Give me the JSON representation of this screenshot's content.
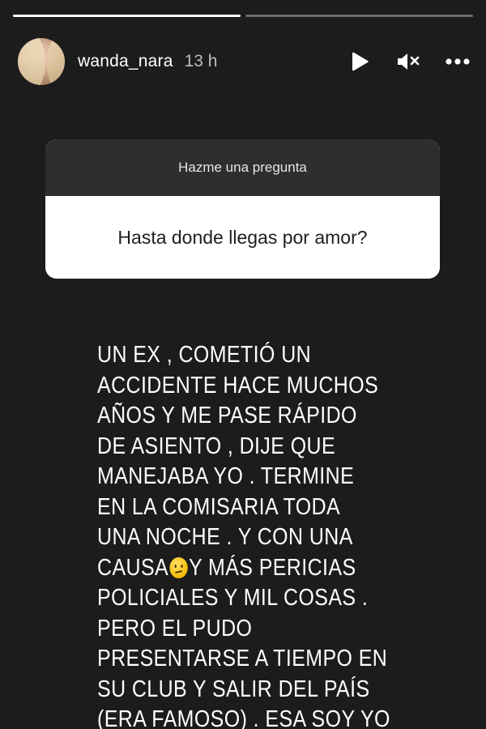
{
  "progress": {
    "segments": 2,
    "active_index": 0,
    "active_fill": 1.0
  },
  "header": {
    "username": "wanda_nara",
    "time_ago": "13 h",
    "icons": [
      "play-icon",
      "mute-icon",
      "more-icon"
    ]
  },
  "question": {
    "prompt_label": "Hazme una pregunta",
    "text": "Hasta donde llegas por amor?"
  },
  "answer": {
    "lines": [
      "UN EX , COMETIÓ UN",
      "ACCIDENTE HACE MUCHOS",
      "AÑOS  Y ME PASE RÁPIDO",
      "DE ASIENTO , DIJE QUE",
      "MANEJABA YO . TERMINE",
      "EN LA COMISARIA TODA",
      "UNA NOCHE  . Y CON UNA",
      "CAUSA",
      "Y MÁS PERICIAS",
      "POLICIALES Y MIL COSAS .",
      "PERO EL PUDO",
      "PRESENTARSE A TIEMPO EN",
      "SU CLUB Y SALIR DEL PAÍS",
      "(ERA FAMOSO) . ESA SOY YO"
    ],
    "emoji": "confused-face"
  },
  "colors": {
    "background": "#1c1c1c",
    "card_header": "#2e2e2e",
    "card_body": "#ffffff",
    "text": "#ffffff"
  }
}
